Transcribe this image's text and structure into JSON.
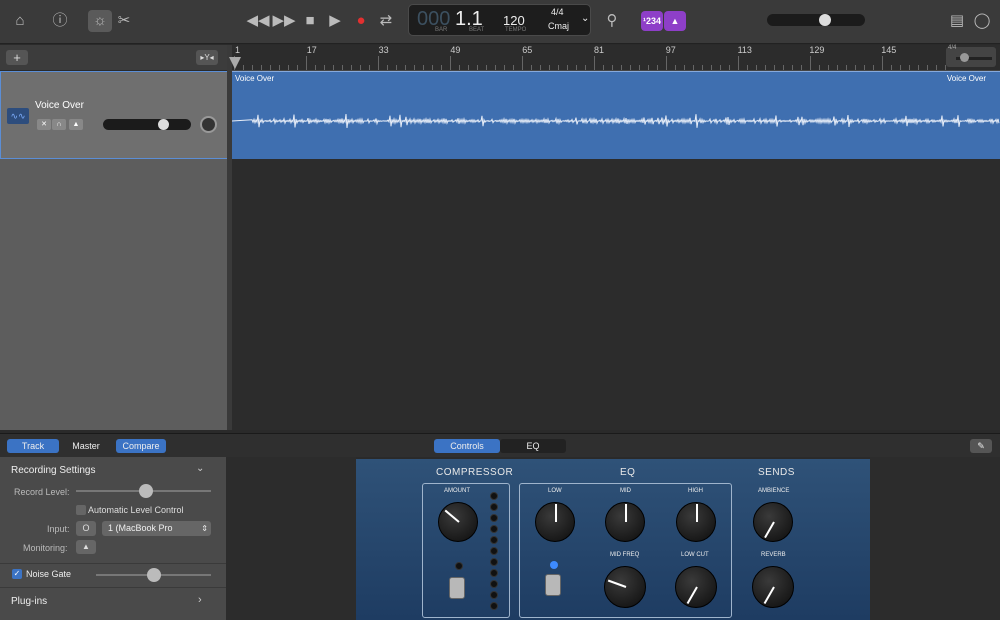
{
  "toolbar": {
    "left_icons": [
      "library-icon",
      "help-icon",
      "smart-controls-icon",
      "editors-icon"
    ],
    "transport": {
      "rewind": "◀◀",
      "forward": "▶▶",
      "stop": "■",
      "play": "▶",
      "record": "●",
      "cycle": "⇄"
    },
    "lcd": {
      "bar_ghost": "000",
      "position": "1.1",
      "tempo": "120",
      "time_sig": "4/4",
      "key": "Cmaj",
      "bar_label": "BAR",
      "beat_label": "BEAT",
      "tempo_label": "TEMPO"
    },
    "count_in_label": "¹234",
    "master_volume": 0.6
  },
  "tracks": {
    "add_label": "+",
    "filter_label": "▸Y◂",
    "items": [
      {
        "name": "Voice Over",
        "volume": 0.72
      }
    ]
  },
  "ruler": {
    "marks": [
      "1",
      "17",
      "33",
      "49",
      "65",
      "81",
      "97",
      "113",
      "129",
      "145"
    ],
    "time_sig": "4/4"
  },
  "region": {
    "name_left": "Voice Over",
    "name_right": "Voice Over"
  },
  "bottom": {
    "tabs_left": [
      "Track",
      "Master",
      "Compare"
    ],
    "tabs_center": [
      "Controls",
      "EQ"
    ]
  },
  "inspector": {
    "recording_settings": "Recording Settings",
    "record_level": "Record Level:",
    "auto_level": "Automatic Level Control",
    "input_label": "Input:",
    "input_value": "1  (MacBook Pro",
    "monitoring_label": "Monitoring:",
    "noise_gate": "Noise Gate",
    "plugins": "Plug-ins",
    "record_level_value": 0.52,
    "noise_gate_value": 0.5
  },
  "plugin": {
    "compressor": "COMPRESSOR",
    "eq": "EQ",
    "sends": "SENDS",
    "knobs": {
      "amount": "AMOUNT",
      "low": "LOW",
      "mid": "MID",
      "high": "HIGH",
      "mid_freq": "MID FREQ",
      "low_cut": "LOW CUT",
      "ambience": "AMBIENCE",
      "reverb": "REVERB"
    }
  }
}
